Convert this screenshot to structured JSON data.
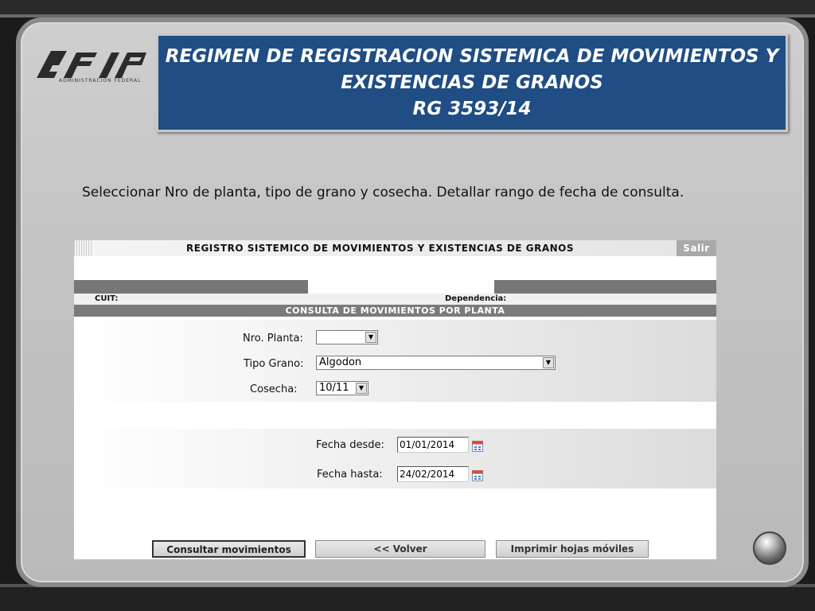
{
  "logo": {
    "text": "AFIP",
    "subtitle": "ADMINISTRACION FEDERAL"
  },
  "header": {
    "line1": "REGIMEN DE REGISTRACION SISTEMICA DE MOVIMIENTOS Y",
    "line2": "EXISTENCIAS DE GRANOS",
    "line3": "RG  3593/14"
  },
  "instruction": "Seleccionar Nro de planta, tipo de grano y cosecha. Detallar rango de fecha de consulta.",
  "app": {
    "title": "REGISTRO SISTEMICO DE MOVIMIENTOS Y EXISTENCIAS DE GRANOS",
    "salir": "Salir",
    "cuit_label": "CUIT:",
    "dependencia_label": "Dependencia:",
    "section_title": "CONSULTA DE MOVIMIENTOS POR PLANTA",
    "fields": {
      "planta_label": "Nro. Planta:",
      "planta_value": "",
      "grano_label": "Tipo Grano:",
      "grano_value": "Algodon",
      "cosecha_label": "Cosecha:",
      "cosecha_value": "10/11",
      "desde_label": "Fecha desde:",
      "desde_value": "01/01/2014",
      "hasta_label": "Fecha hasta:",
      "hasta_value": "24/02/2014"
    },
    "buttons": {
      "consultar": "Consultar movimientos",
      "volver": "<< Volver",
      "imprimir": "Imprimir hojas móviles"
    }
  },
  "colors": {
    "header_bg": "#1f4d84",
    "section_bg": "#7b7b7b"
  }
}
